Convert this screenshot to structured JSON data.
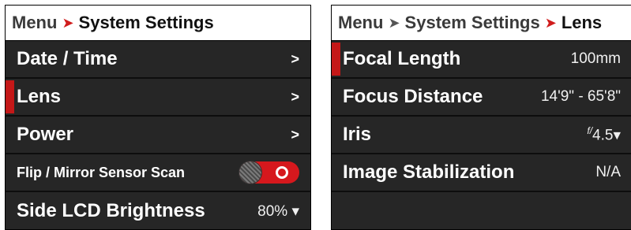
{
  "left": {
    "breadcrumb": {
      "root": "Menu",
      "current": "System Settings"
    },
    "rows": [
      {
        "label": "Date / Time",
        "arrow": ">"
      },
      {
        "label": "Lens",
        "arrow": ">",
        "selected": true
      },
      {
        "label": "Power",
        "arrow": ">"
      },
      {
        "label": "Flip / Mirror Sensor Scan",
        "toggle": "on"
      },
      {
        "label": "Side LCD Brightness",
        "value": "80% ▾"
      }
    ]
  },
  "right": {
    "breadcrumb": {
      "root": "Menu",
      "middle": "System Settings",
      "current": "Lens"
    },
    "rows": [
      {
        "label": "Focal Length",
        "value": "100mm",
        "selected": true
      },
      {
        "label": "Focus Distance",
        "value": "14'9\" - 65'8\""
      },
      {
        "label": "Iris",
        "value_prefix": "f/",
        "value": "4.5",
        "dropdown": "▾"
      },
      {
        "label": "Image Stabilization",
        "value": "N/A"
      }
    ]
  },
  "colors": {
    "accent_red": "#d01c1c",
    "panel_bg": "#262626"
  },
  "icons": {
    "chevron": "chevron-right-icon",
    "dropdown": "chevron-down-icon"
  }
}
